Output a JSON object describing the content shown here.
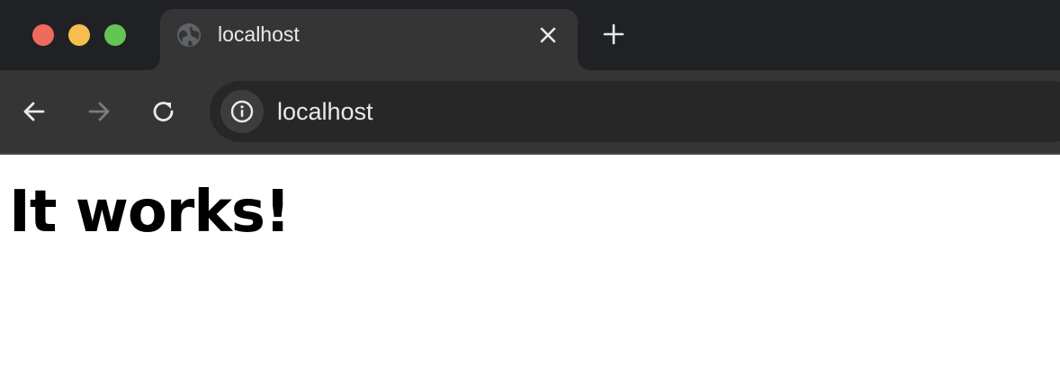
{
  "window": {
    "traffic_lights": {
      "close_color": "#ee6a5f",
      "minimize_color": "#f5be4f",
      "maximize_color": "#62c554"
    }
  },
  "tab": {
    "title": "localhost",
    "favicon": "globe-icon",
    "close_icon": "close-icon"
  },
  "new_tab": {
    "icon": "plus-icon"
  },
  "toolbar": {
    "back_icon": "arrow-left-icon",
    "forward_icon": "arrow-right-icon",
    "forward_enabled": false,
    "reload_icon": "reload-icon",
    "site_info_icon": "info-icon",
    "url": "localhost"
  },
  "page": {
    "heading": "It works!"
  },
  "colors": {
    "tabstrip_bg": "#202124",
    "active_tab_bg": "#353535",
    "omnibox_bg": "#272727",
    "text_light": "#e8eaed",
    "page_bg": "#ffffff"
  }
}
